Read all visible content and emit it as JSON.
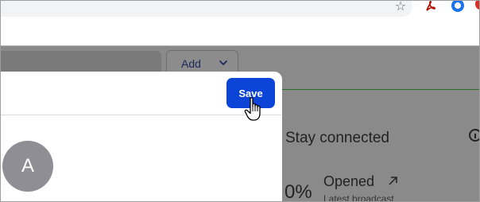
{
  "browser": {
    "icons": [
      "star-icon",
      "pdf-extension-icon",
      "blue-extension-icon",
      "red-extension-icon"
    ]
  },
  "toolbar": {
    "add_label": "Add"
  },
  "modal": {
    "save_label": "Save",
    "avatar_initial": "A"
  },
  "stats": {
    "title": "Stay connected",
    "percent": "0%",
    "opened_label": "Opened",
    "latest_label": "Latest broadcast"
  },
  "colors": {
    "accent": "#0b44d6",
    "overlay": "#8a8a8a",
    "green_line": "#2d6a2d"
  }
}
